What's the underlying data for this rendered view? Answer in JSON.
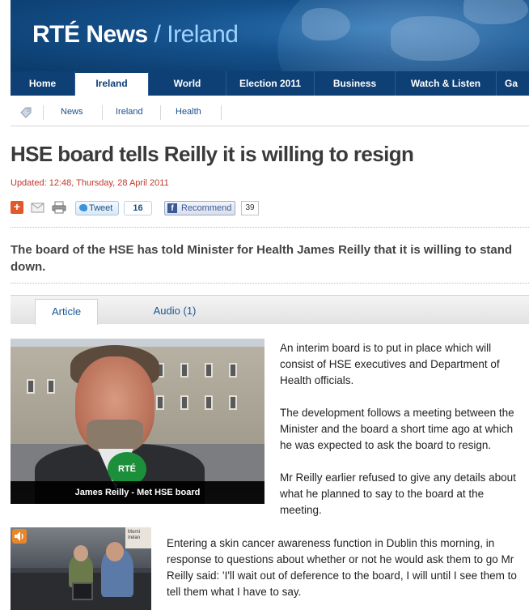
{
  "header": {
    "logo_brand": "RTÉ News",
    "logo_separator": "/",
    "logo_section": "Ireland"
  },
  "nav": {
    "items": [
      {
        "label": "Home",
        "active": false
      },
      {
        "label": "Ireland",
        "active": true
      },
      {
        "label": "World",
        "active": false
      },
      {
        "label": "Election 2011",
        "active": false
      },
      {
        "label": "Business",
        "active": false
      },
      {
        "label": "Watch & Listen",
        "active": false
      },
      {
        "label": "Ga",
        "active": false
      }
    ]
  },
  "breadcrumb": {
    "icon": "tag-icon",
    "items": [
      "News",
      "Ireland",
      "Health"
    ]
  },
  "article": {
    "title": "HSE board tells Reilly it is willing to resign",
    "updated": "Updated: 12:48, Thursday, 28 April 2011",
    "standfirst": "The board of the HSE has told Minister for Health James Reilly that it is willing to stand down.",
    "tabs": [
      {
        "label": "Article",
        "active": true
      },
      {
        "label": "Audio (1)",
        "active": false
      }
    ],
    "photo_caption": "James Reilly - Met HSE board",
    "mic_label": "RTÉ",
    "studio_sign": "Morni Irelan",
    "paragraphs": [
      "An interim board is to put in place which will consist of HSE executives and Department of Health officials.",
      "The development follows a meeting between the Minister and the board a short time ago at which he was expected to ask the board to resign.",
      "Mr Reilly earlier refused to give any details about what he planned to say to the board at the meeting.",
      "Entering a skin cancer awareness function in Dublin this morning, in response to questions about whether or not he would ask them to go Mr Reilly said: 'I'll wait out of deference to the board, I will until I see them to tell them what I have to say."
    ]
  },
  "share": {
    "icons": [
      "plus-icon",
      "mail-icon",
      "print-icon"
    ],
    "plus_glyph": "+",
    "tweet_label": "Tweet",
    "tweet_count": "16",
    "fb_glyph": "f",
    "recommend_label": "Recommend",
    "recommend_count": "39"
  },
  "colors": {
    "nav_bg": "#0e3f75",
    "link": "#1a4f8b",
    "updated": "#c0392b",
    "accent_orange": "#e2582b"
  }
}
